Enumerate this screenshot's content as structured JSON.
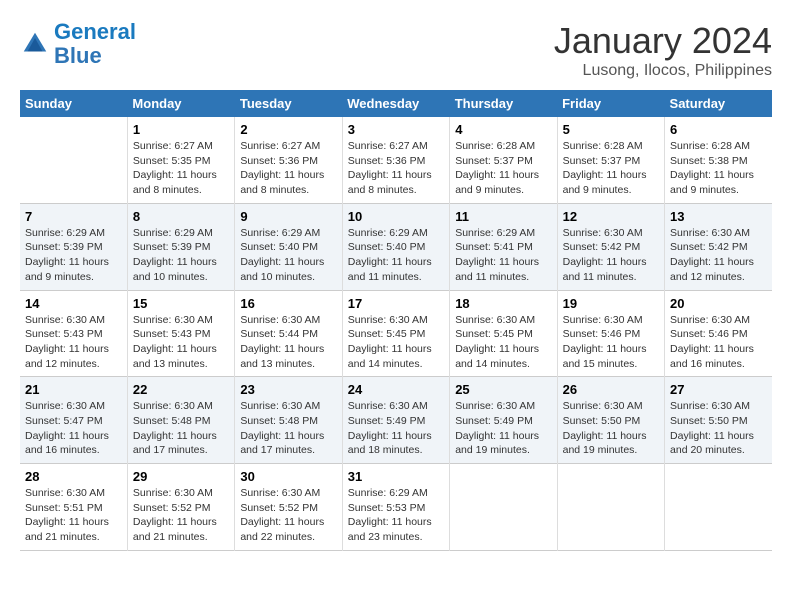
{
  "header": {
    "logo_line1": "General",
    "logo_line2": "Blue",
    "title": "January 2024",
    "subtitle": "Lusong, Ilocos, Philippines"
  },
  "weekdays": [
    "Sunday",
    "Monday",
    "Tuesday",
    "Wednesday",
    "Thursday",
    "Friday",
    "Saturday"
  ],
  "weeks": [
    [
      {
        "num": "",
        "sunrise": "",
        "sunset": "",
        "daylight": ""
      },
      {
        "num": "1",
        "sunrise": "Sunrise: 6:27 AM",
        "sunset": "Sunset: 5:35 PM",
        "daylight": "Daylight: 11 hours and 8 minutes."
      },
      {
        "num": "2",
        "sunrise": "Sunrise: 6:27 AM",
        "sunset": "Sunset: 5:36 PM",
        "daylight": "Daylight: 11 hours and 8 minutes."
      },
      {
        "num": "3",
        "sunrise": "Sunrise: 6:27 AM",
        "sunset": "Sunset: 5:36 PM",
        "daylight": "Daylight: 11 hours and 8 minutes."
      },
      {
        "num": "4",
        "sunrise": "Sunrise: 6:28 AM",
        "sunset": "Sunset: 5:37 PM",
        "daylight": "Daylight: 11 hours and 9 minutes."
      },
      {
        "num": "5",
        "sunrise": "Sunrise: 6:28 AM",
        "sunset": "Sunset: 5:37 PM",
        "daylight": "Daylight: 11 hours and 9 minutes."
      },
      {
        "num": "6",
        "sunrise": "Sunrise: 6:28 AM",
        "sunset": "Sunset: 5:38 PM",
        "daylight": "Daylight: 11 hours and 9 minutes."
      }
    ],
    [
      {
        "num": "7",
        "sunrise": "Sunrise: 6:29 AM",
        "sunset": "Sunset: 5:39 PM",
        "daylight": "Daylight: 11 hours and 9 minutes."
      },
      {
        "num": "8",
        "sunrise": "Sunrise: 6:29 AM",
        "sunset": "Sunset: 5:39 PM",
        "daylight": "Daylight: 11 hours and 10 minutes."
      },
      {
        "num": "9",
        "sunrise": "Sunrise: 6:29 AM",
        "sunset": "Sunset: 5:40 PM",
        "daylight": "Daylight: 11 hours and 10 minutes."
      },
      {
        "num": "10",
        "sunrise": "Sunrise: 6:29 AM",
        "sunset": "Sunset: 5:40 PM",
        "daylight": "Daylight: 11 hours and 11 minutes."
      },
      {
        "num": "11",
        "sunrise": "Sunrise: 6:29 AM",
        "sunset": "Sunset: 5:41 PM",
        "daylight": "Daylight: 11 hours and 11 minutes."
      },
      {
        "num": "12",
        "sunrise": "Sunrise: 6:30 AM",
        "sunset": "Sunset: 5:42 PM",
        "daylight": "Daylight: 11 hours and 11 minutes."
      },
      {
        "num": "13",
        "sunrise": "Sunrise: 6:30 AM",
        "sunset": "Sunset: 5:42 PM",
        "daylight": "Daylight: 11 hours and 12 minutes."
      }
    ],
    [
      {
        "num": "14",
        "sunrise": "Sunrise: 6:30 AM",
        "sunset": "Sunset: 5:43 PM",
        "daylight": "Daylight: 11 hours and 12 minutes."
      },
      {
        "num": "15",
        "sunrise": "Sunrise: 6:30 AM",
        "sunset": "Sunset: 5:43 PM",
        "daylight": "Daylight: 11 hours and 13 minutes."
      },
      {
        "num": "16",
        "sunrise": "Sunrise: 6:30 AM",
        "sunset": "Sunset: 5:44 PM",
        "daylight": "Daylight: 11 hours and 13 minutes."
      },
      {
        "num": "17",
        "sunrise": "Sunrise: 6:30 AM",
        "sunset": "Sunset: 5:45 PM",
        "daylight": "Daylight: 11 hours and 14 minutes."
      },
      {
        "num": "18",
        "sunrise": "Sunrise: 6:30 AM",
        "sunset": "Sunset: 5:45 PM",
        "daylight": "Daylight: 11 hours and 14 minutes."
      },
      {
        "num": "19",
        "sunrise": "Sunrise: 6:30 AM",
        "sunset": "Sunset: 5:46 PM",
        "daylight": "Daylight: 11 hours and 15 minutes."
      },
      {
        "num": "20",
        "sunrise": "Sunrise: 6:30 AM",
        "sunset": "Sunset: 5:46 PM",
        "daylight": "Daylight: 11 hours and 16 minutes."
      }
    ],
    [
      {
        "num": "21",
        "sunrise": "Sunrise: 6:30 AM",
        "sunset": "Sunset: 5:47 PM",
        "daylight": "Daylight: 11 hours and 16 minutes."
      },
      {
        "num": "22",
        "sunrise": "Sunrise: 6:30 AM",
        "sunset": "Sunset: 5:48 PM",
        "daylight": "Daylight: 11 hours and 17 minutes."
      },
      {
        "num": "23",
        "sunrise": "Sunrise: 6:30 AM",
        "sunset": "Sunset: 5:48 PM",
        "daylight": "Daylight: 11 hours and 17 minutes."
      },
      {
        "num": "24",
        "sunrise": "Sunrise: 6:30 AM",
        "sunset": "Sunset: 5:49 PM",
        "daylight": "Daylight: 11 hours and 18 minutes."
      },
      {
        "num": "25",
        "sunrise": "Sunrise: 6:30 AM",
        "sunset": "Sunset: 5:49 PM",
        "daylight": "Daylight: 11 hours and 19 minutes."
      },
      {
        "num": "26",
        "sunrise": "Sunrise: 6:30 AM",
        "sunset": "Sunset: 5:50 PM",
        "daylight": "Daylight: 11 hours and 19 minutes."
      },
      {
        "num": "27",
        "sunrise": "Sunrise: 6:30 AM",
        "sunset": "Sunset: 5:50 PM",
        "daylight": "Daylight: 11 hours and 20 minutes."
      }
    ],
    [
      {
        "num": "28",
        "sunrise": "Sunrise: 6:30 AM",
        "sunset": "Sunset: 5:51 PM",
        "daylight": "Daylight: 11 hours and 21 minutes."
      },
      {
        "num": "29",
        "sunrise": "Sunrise: 6:30 AM",
        "sunset": "Sunset: 5:52 PM",
        "daylight": "Daylight: 11 hours and 21 minutes."
      },
      {
        "num": "30",
        "sunrise": "Sunrise: 6:30 AM",
        "sunset": "Sunset: 5:52 PM",
        "daylight": "Daylight: 11 hours and 22 minutes."
      },
      {
        "num": "31",
        "sunrise": "Sunrise: 6:29 AM",
        "sunset": "Sunset: 5:53 PM",
        "daylight": "Daylight: 11 hours and 23 minutes."
      },
      {
        "num": "",
        "sunrise": "",
        "sunset": "",
        "daylight": ""
      },
      {
        "num": "",
        "sunrise": "",
        "sunset": "",
        "daylight": ""
      },
      {
        "num": "",
        "sunrise": "",
        "sunset": "",
        "daylight": ""
      }
    ]
  ]
}
